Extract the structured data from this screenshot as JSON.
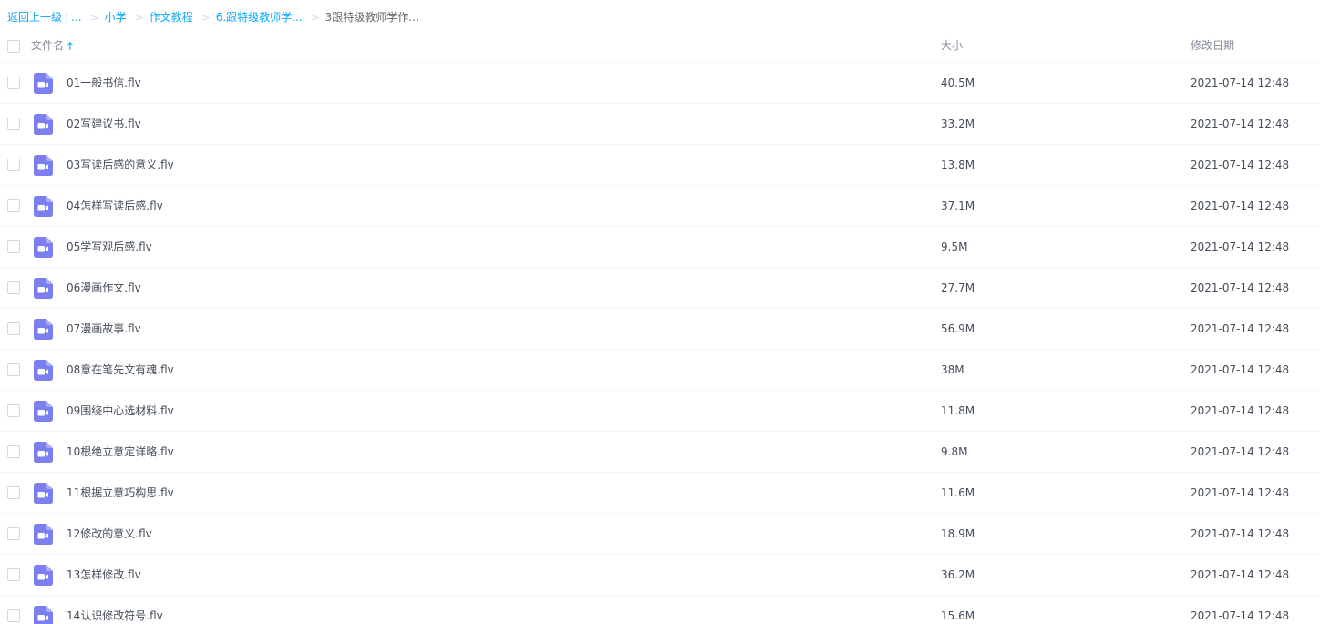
{
  "breadcrumb": {
    "back": "返回上一级",
    "pipe": "|",
    "ellipsis": "...",
    "items": [
      "小学",
      "作文教程",
      "6.跟特级教师学..."
    ],
    "current": "3跟特级教师学作...",
    "separator": ">"
  },
  "columns": {
    "name": "文件名",
    "size": "大小",
    "date": "修改日期",
    "sort_icon": "arrow-up-icon",
    "sort_symbol": "🡑"
  },
  "file_icon": "video-file-icon",
  "colors": {
    "accent": "#09aaff",
    "video_icon": "#7b7fef"
  },
  "files": [
    {
      "name": "01一般书信.flv",
      "size": "40.5M",
      "date": "2021-07-14 12:48"
    },
    {
      "name": "02写建议书.flv",
      "size": "33.2M",
      "date": "2021-07-14 12:48"
    },
    {
      "name": "03写读后感的意义.flv",
      "size": "13.8M",
      "date": "2021-07-14 12:48"
    },
    {
      "name": "04怎样写读后感.flv",
      "size": "37.1M",
      "date": "2021-07-14 12:48"
    },
    {
      "name": "05学写观后感.flv",
      "size": "9.5M",
      "date": "2021-07-14 12:48"
    },
    {
      "name": "06漫画作文.flv",
      "size": "27.7M",
      "date": "2021-07-14 12:48"
    },
    {
      "name": "07漫画故事.flv",
      "size": "56.9M",
      "date": "2021-07-14 12:48"
    },
    {
      "name": "08意在笔先文有魂.flv",
      "size": "38M",
      "date": "2021-07-14 12:48"
    },
    {
      "name": "09围绕中心选材料.flv",
      "size": "11.8M",
      "date": "2021-07-14 12:48"
    },
    {
      "name": "10根绝立意定详略.flv",
      "size": "9.8M",
      "date": "2021-07-14 12:48"
    },
    {
      "name": "11根据立意巧构思.flv",
      "size": "11.6M",
      "date": "2021-07-14 12:48"
    },
    {
      "name": "12修改的意义.flv",
      "size": "18.9M",
      "date": "2021-07-14 12:48"
    },
    {
      "name": "13怎样修改.flv",
      "size": "36.2M",
      "date": "2021-07-14 12:48"
    },
    {
      "name": "14认识修改符号.flv",
      "size": "15.6M",
      "date": "2021-07-14 12:48"
    }
  ]
}
